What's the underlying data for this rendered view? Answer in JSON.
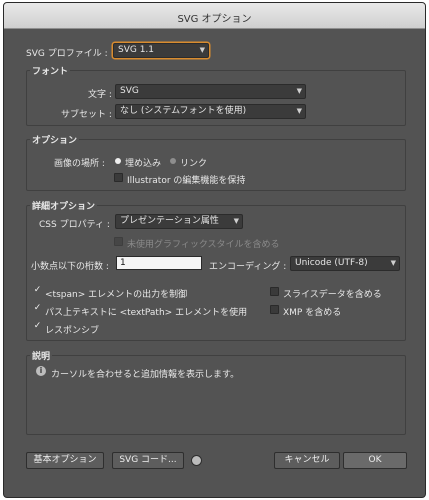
{
  "window": {
    "title": "SVG オプション"
  },
  "profile": {
    "label": "SVG プロファイル :",
    "value": "SVG 1.1"
  },
  "font": {
    "title": "フォント",
    "char_label": "文字 :",
    "char_value": "SVG",
    "subset_label": "サブセット :",
    "subset_value": "なし (システムフォントを使用)"
  },
  "options": {
    "title": "オプション",
    "image_location_label": "画像の場所 :",
    "embed_label": "埋め込み",
    "link_label": "リンク",
    "preserve_label": "Illustrator の編集機能を保持"
  },
  "advanced": {
    "title": "詳細オプション",
    "css_label": "CSS プロパティ :",
    "css_value": "プレゼンテーション属性",
    "unused_styles_label": "未使用グラフィックスタイルを含める",
    "decimal_label": "小数点以下の桁数 :",
    "decimal_value": "1",
    "encoding_label": "エンコーディング :",
    "encoding_value": "Unicode (UTF-8)",
    "tspan_label": "<tspan> エレメントの出力を制御",
    "textpath_label": "パス上テキストに <textPath> エレメントを使用",
    "responsive_label": "レスポンシブ",
    "slice_label": "スライスデータを含める",
    "xmp_label": "XMP を含める"
  },
  "description": {
    "title": "説明",
    "text": "カーソルを合わせると追加情報を表示します。"
  },
  "buttons": {
    "basic": "基本オプション",
    "svg_code": "SVG コード...",
    "cancel": "キャンセル",
    "ok": "OK"
  },
  "icons": {
    "dropdown": "chevron-down-icon",
    "info": "info-icon",
    "globe": "globe-icon"
  },
  "state": {
    "image_location": "embed",
    "preserve": false,
    "unused_styles": false,
    "tspan": true,
    "textpath": true,
    "responsive": true,
    "slice": false,
    "xmp": false
  }
}
